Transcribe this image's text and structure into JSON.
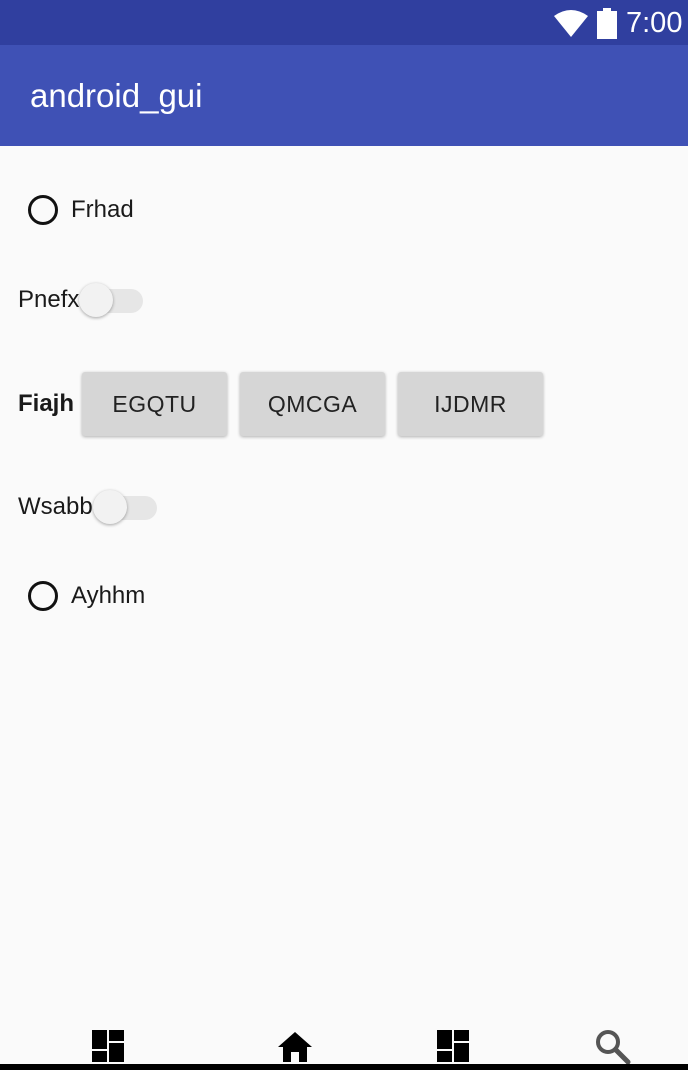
{
  "status_bar": {
    "time": "7:00",
    "wifi_icon": "wifi-icon",
    "battery_icon": "battery-icon",
    "background": "#303f9f"
  },
  "app_bar": {
    "title": "android_gui",
    "background": "#3f51b5"
  },
  "content": {
    "radio_1": {
      "label": "Frhad",
      "checked": false
    },
    "switch_1": {
      "label": "Pnefx",
      "on": false
    },
    "button_row": {
      "label": "Fiajh",
      "buttons": [
        "EGQTU",
        "QMCGA",
        "IJDMR"
      ]
    },
    "switch_2": {
      "label": "Wsabb",
      "on": false
    },
    "radio_2": {
      "label": "Ayhhm",
      "checked": false
    }
  },
  "bottom_nav": {
    "items": [
      {
        "icon": "dashboard-icon"
      },
      {
        "icon": "home-icon"
      },
      {
        "icon": "dashboard-icon"
      },
      {
        "icon": "search-icon"
      }
    ]
  }
}
